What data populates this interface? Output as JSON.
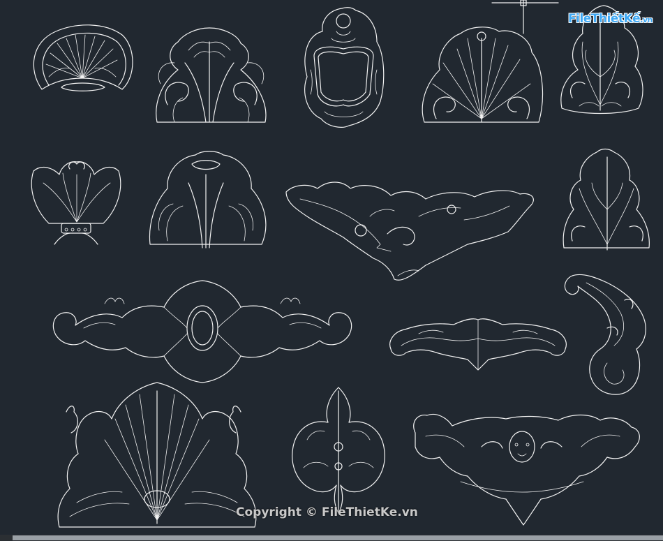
{
  "viewport": {
    "background": "#212830",
    "line_color": "#f2f2f2"
  },
  "watermark": {
    "logo_main": "FileThiếtKế",
    "logo_suffix": ".vn",
    "copyright": "Copyright © FileThietKe.vn",
    "logo_color": "#3fa9f5"
  },
  "ornaments": [
    {
      "id": "shell"
    },
    {
      "id": "acanthus-crest-1"
    },
    {
      "id": "oval-cartouche-frame"
    },
    {
      "id": "acanthus-fan"
    },
    {
      "id": "acanthus-corner"
    },
    {
      "id": "palmette-with-band"
    },
    {
      "id": "acanthus-crest-2"
    },
    {
      "id": "baroque-scroll-bracket"
    },
    {
      "id": "acanthus-leaf-tall"
    },
    {
      "id": "horizontal-frieze-medallion"
    },
    {
      "id": "volute-scroll"
    },
    {
      "id": "winged-scroll"
    },
    {
      "id": "large-palmette-crest"
    },
    {
      "id": "leaf-cartouche"
    },
    {
      "id": "mask-scroll-frieze"
    }
  ],
  "ucs_icon": {
    "name": "ucs-crosshair-icon"
  },
  "scrollbar": {
    "name": "horizontal-scrollbar"
  }
}
